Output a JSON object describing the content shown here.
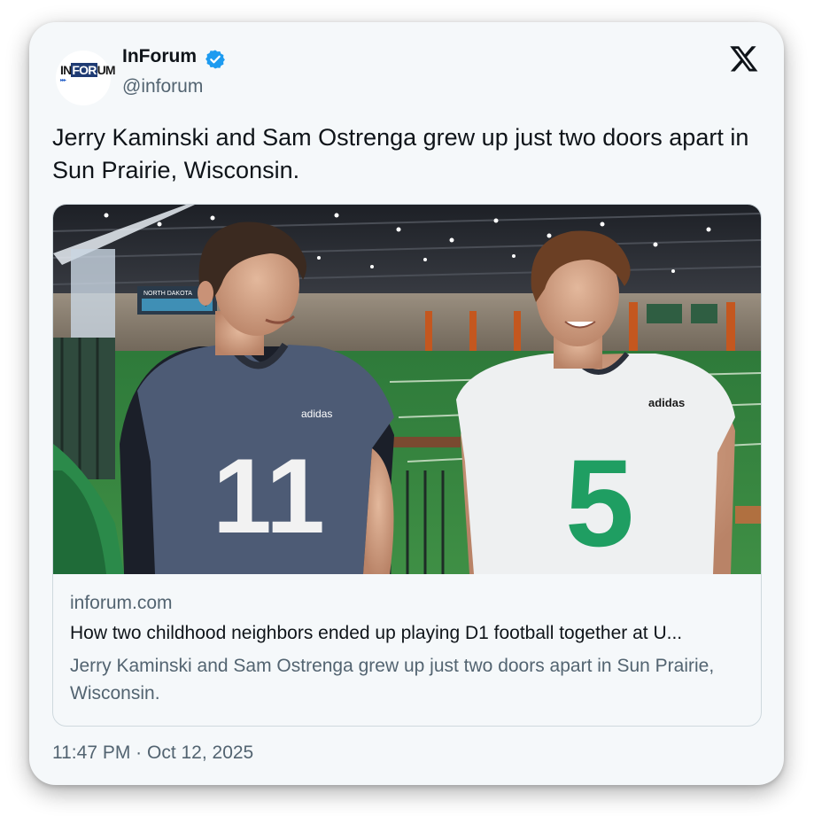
{
  "tweet": {
    "display_name": "InForum",
    "handle": "@inforum",
    "verified": true,
    "text": "Jerry Kaminski and Sam Ostrenga grew up just two doors apart in Sun Prairie, Wisconsin.",
    "timestamp": "11:47 PM · Oct 12, 2025"
  },
  "avatar": {
    "logo_left": "IN",
    "logo_mid": "FOR",
    "logo_right": "UM",
    "arrows": "▸▸▸"
  },
  "link_card": {
    "domain": "inforum.com",
    "title": "How two childhood neighbors ended up playing D1 football together at U...",
    "description": "Jerry Kaminski and Sam Ostrenga grew up just two doors apart in Sun Prairie, Wisconsin.",
    "image": {
      "left_jersey_number": "11",
      "right_jersey_number": "5",
      "brand_left": "adidas",
      "brand_right": "adidas",
      "banner_text": "NORTH DAKOTA"
    }
  },
  "icons": {
    "verified": "verified-badge-icon",
    "x_logo": "x-logo-icon"
  },
  "colors": {
    "card_bg": "#f5f8fa",
    "verified_blue": "#1d9bf0",
    "text_primary": "#0f1419",
    "text_secondary": "#536471",
    "border": "#cfd9de",
    "jersey_green": "#1f9e62",
    "jersey_navy": "#4b5a74"
  }
}
